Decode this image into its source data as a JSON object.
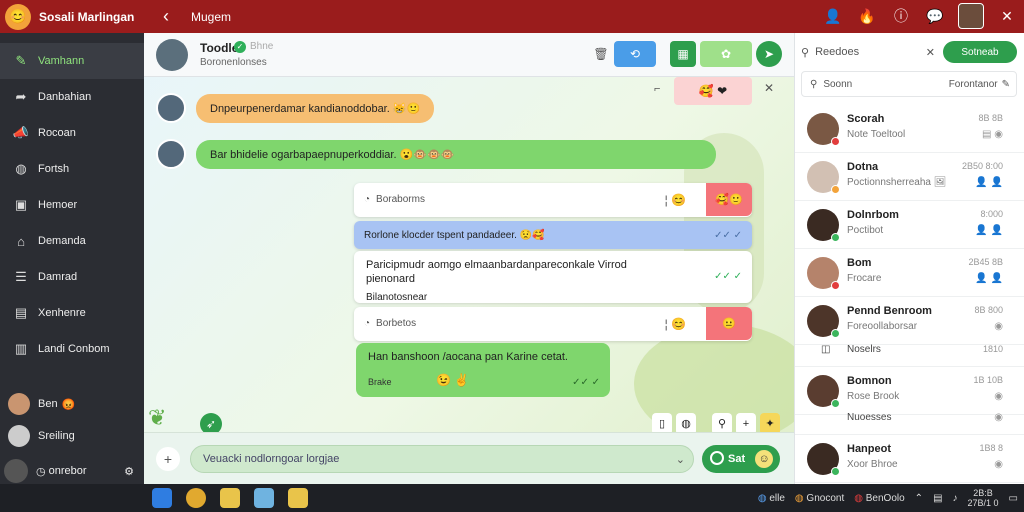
{
  "topbar": {
    "app_title": "Sosali Marlingan",
    "title": "Mugem",
    "back_icon": "arrow-left-icon"
  },
  "sidebar": {
    "items": [
      {
        "label": "Vamhann",
        "icon": "pencil-icon",
        "active": true
      },
      {
        "label": "Danbahian",
        "icon": "share-icon"
      },
      {
        "label": "Rocoan",
        "icon": "megaphone-icon"
      },
      {
        "label": "Fortsh",
        "icon": "globe-icon"
      },
      {
        "label": "Hemoer",
        "icon": "chat-icon"
      },
      {
        "label": "Demanda",
        "icon": "inbox-icon"
      },
      {
        "label": "Damrad",
        "icon": "list-icon"
      },
      {
        "label": "Xenhenre",
        "icon": "image-icon"
      },
      {
        "label": "Landi Conbom",
        "icon": "dashboard-icon"
      }
    ],
    "contacts": [
      {
        "label": "Ben"
      },
      {
        "label": "Sreiling"
      }
    ],
    "bottom_label": "onrebor"
  },
  "chat": {
    "name": "Toodle",
    "name_extra": "Bhne",
    "status": "Boronenlonses",
    "messages": [
      {
        "text": "Dnpeurpenerdamar kandianoddobar. 😸🙂"
      },
      {
        "text": "Bar bhidelie ogarbapaepnuperkoddiar. 😮🐵🐵🐵"
      }
    ],
    "card1": {
      "rows": [
        "Boraborms"
      ],
      "reaction": "🥰🙂"
    },
    "blue_msg": "Rorlone klocder tspent pandadeer. 😟🥰",
    "multi_msg": {
      "line1": "Paricipmudr aomgo elmaanbardanpareconkale Virrod",
      "line2": "pienonard",
      "line3": "Bilanotosnear"
    },
    "card2": {
      "rows": [
        "Borbetos"
      ],
      "reaction": "😐"
    },
    "green_msg": {
      "text": "Han banshoon /aocana pan Karine cetat.",
      "sub": "Brake"
    },
    "composer_placeholder": "Veuacki nodlorngoar lorgjae",
    "send_label": "Sat"
  },
  "rpanel": {
    "search_label": "Reedoes",
    "new_label": "Sotneab",
    "sub_label": "Soonn",
    "sub_right": "Forontanor",
    "contacts": [
      {
        "name": "Scorah",
        "sub": "Note Toeltool",
        "time": "8B 8B",
        "dot": "#e23d3d"
      },
      {
        "name": "Dotna",
        "sub": "Poctionnsherreaha 🖼",
        "time": "2B50 8:00",
        "dot": "#f3a33a"
      },
      {
        "name": "Dolnrbom",
        "sub": "Poctibot",
        "time": "8:000",
        "dot": "#3bb55c"
      },
      {
        "name": "Bom",
        "sub": "Frocare",
        "time": "2B45 8B",
        "dot": "#e23d3d"
      },
      {
        "name": "Pennd Benroom",
        "sub": "Foreoollaborsar",
        "time": "8B 800",
        "dot": "#3bb55c"
      },
      {
        "name": "Bomnon",
        "sub": "Rose Brook",
        "time": "1B 10B",
        "dot": "#3bb55c"
      },
      {
        "name": "Hanpeot",
        "sub": "Xoor Bhroe",
        "time": "1B8 8",
        "dot": "#3bb55c"
      }
    ],
    "plain_rows": [
      {
        "name": "Noselrs",
        "time": "1810"
      },
      {
        "name": "Nuoesses",
        "time": ""
      }
    ]
  },
  "taskbar": {
    "items": [
      "elle",
      "Gnocont",
      "BenOolo"
    ],
    "clock_time": "2B:B",
    "clock_date": "27B/1 0"
  }
}
